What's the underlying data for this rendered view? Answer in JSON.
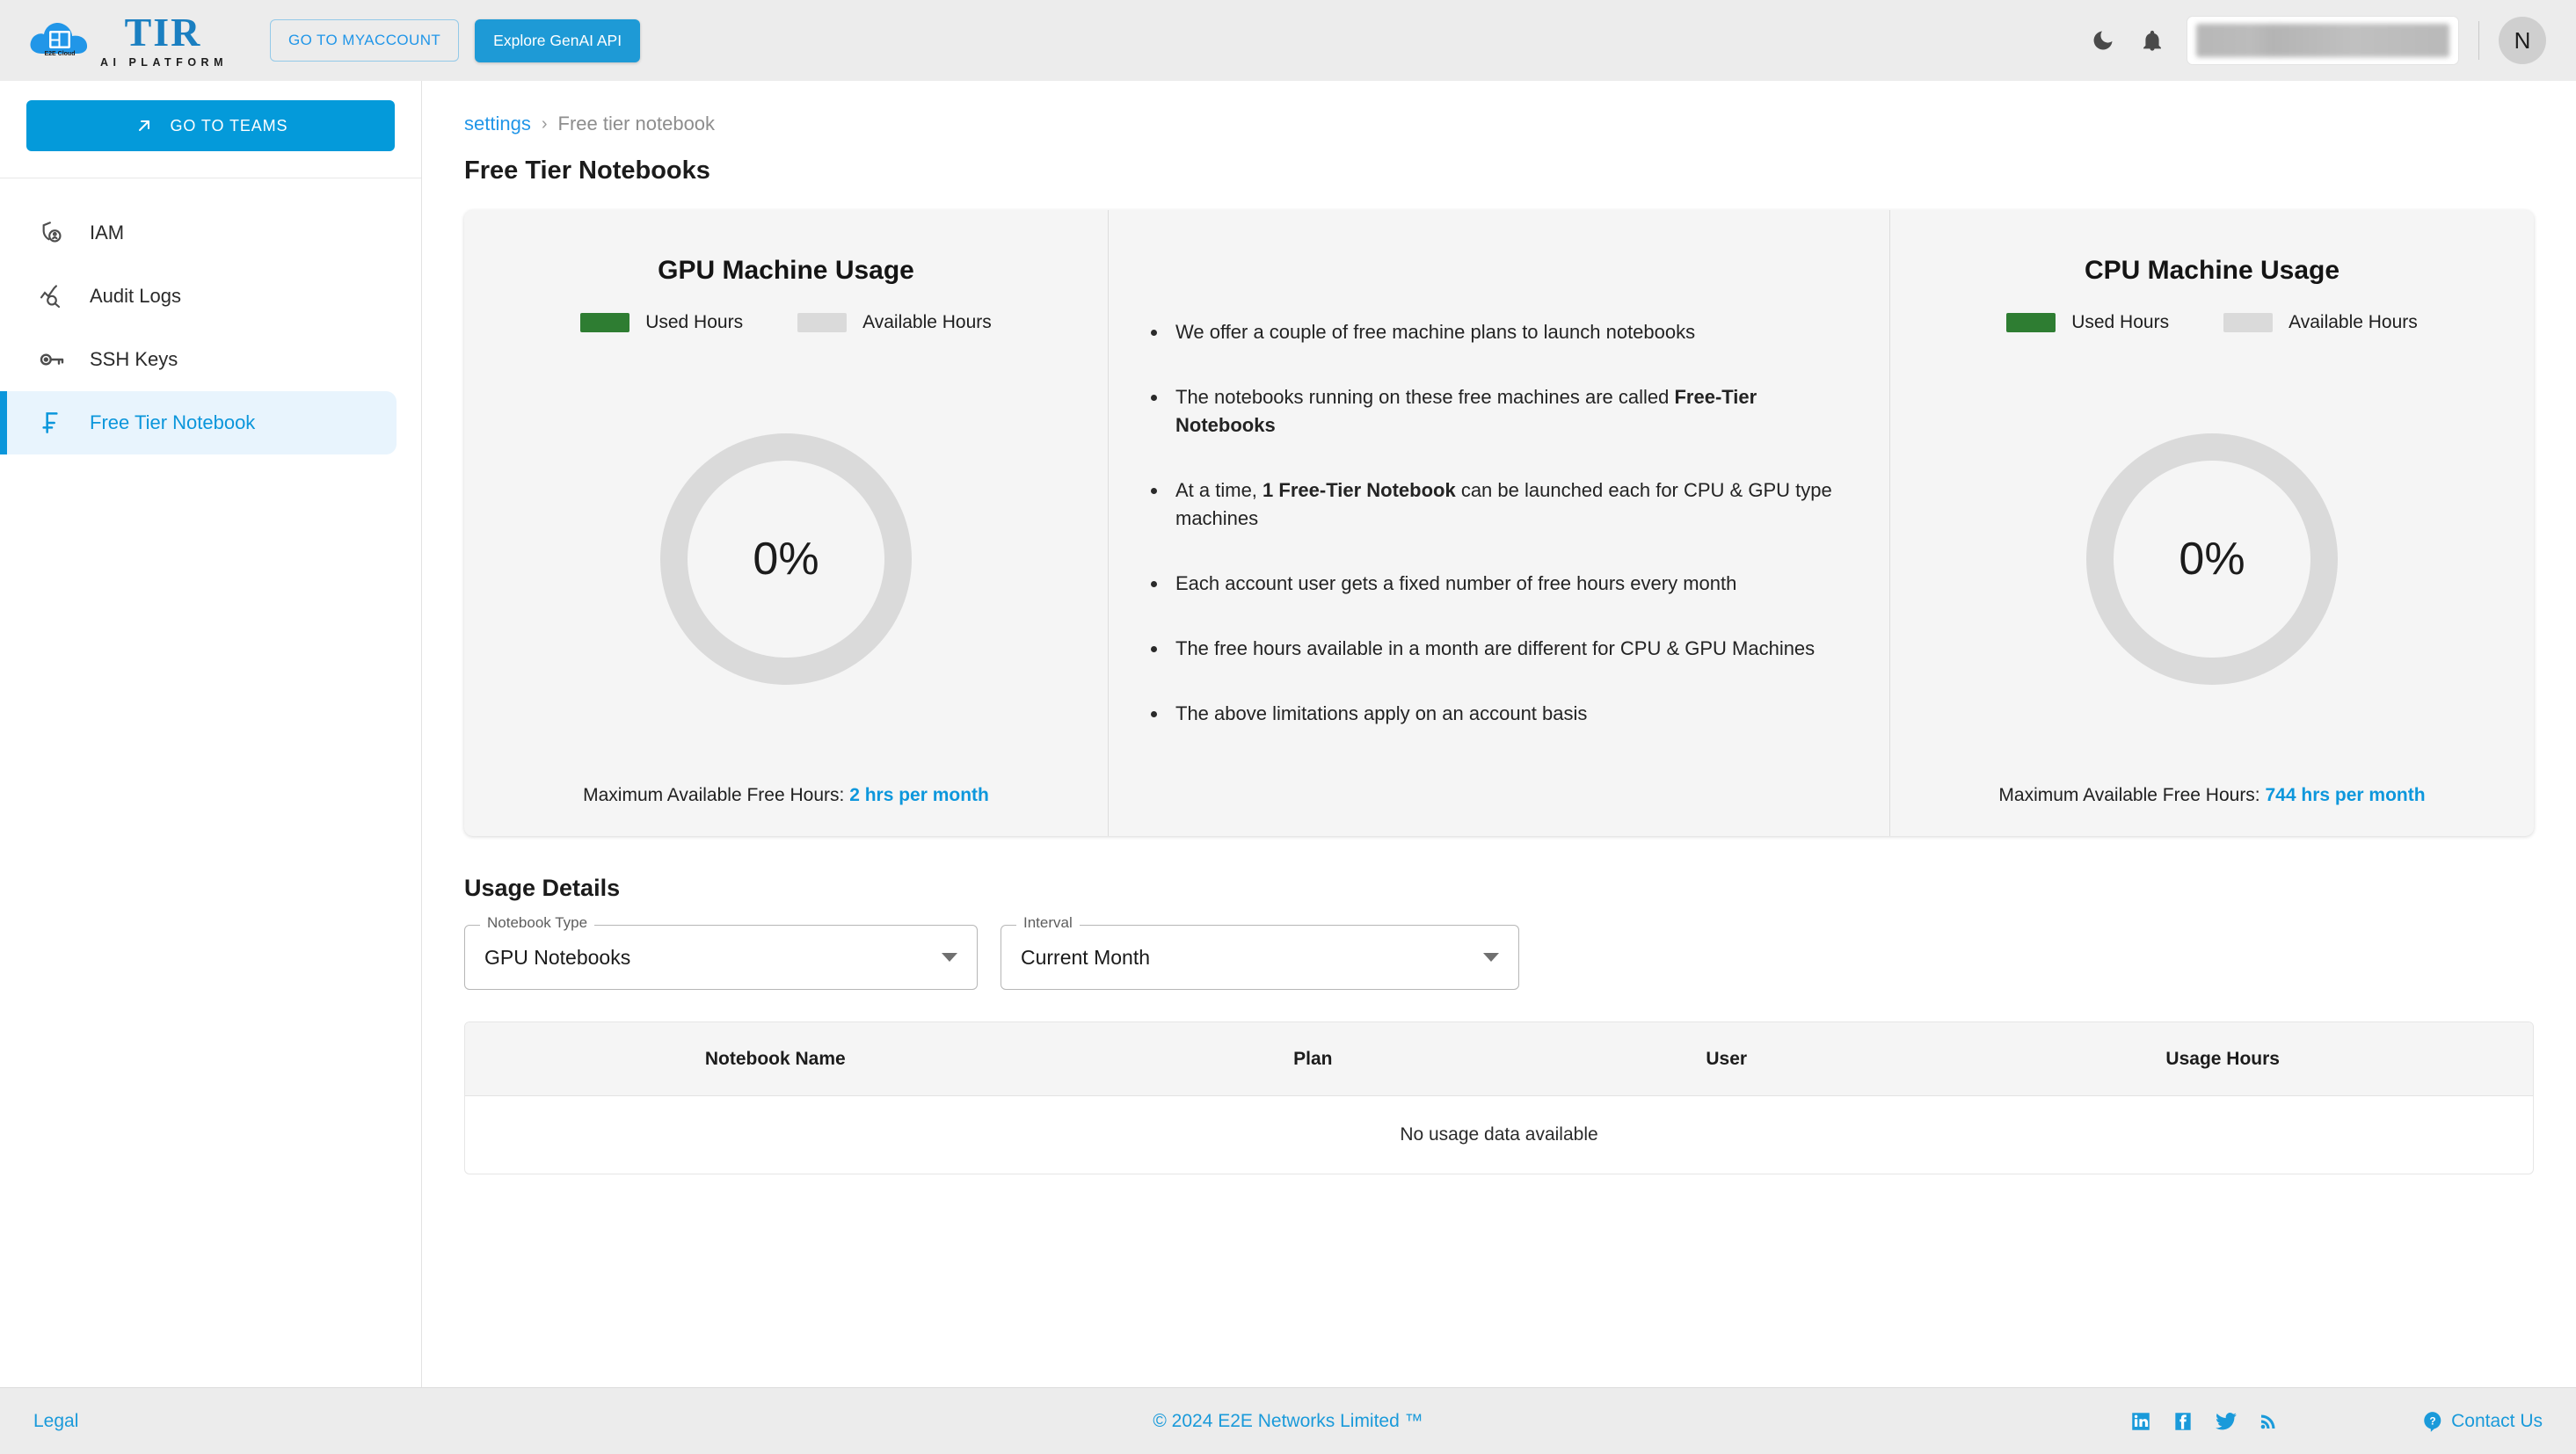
{
  "header": {
    "logo": {
      "brand": "TIR",
      "subtitle": "AI PLATFORM",
      "cloud_text": "E2E Cloud"
    },
    "myaccount_label": "GO TO MYACCOUNT",
    "genai_label": "Explore GenAI API",
    "avatar_initial": "N"
  },
  "sidebar": {
    "teams_button": "GO TO TEAMS",
    "items": [
      {
        "label": "IAM",
        "icon": "shield-user-icon",
        "active": false
      },
      {
        "label": "Audit Logs",
        "icon": "audit-chart-search-icon",
        "active": false
      },
      {
        "label": "SSH Keys",
        "icon": "key-icon",
        "active": false
      },
      {
        "label": "Free Tier Notebook",
        "icon": "free-tier-f-icon",
        "active": true
      }
    ]
  },
  "breadcrumb": {
    "root": "settings",
    "separator": "›",
    "current": "Free tier notebook"
  },
  "page_title": "Free Tier Notebooks",
  "usage": {
    "gpu": {
      "title": "GPU Machine Usage",
      "legend_used": "Used Hours",
      "legend_available": "Available Hours",
      "percent": "0%",
      "max_prefix": "Maximum Available Free Hours:",
      "max_value": "2 hrs per month"
    },
    "cpu": {
      "title": "CPU Machine Usage",
      "legend_used": "Used Hours",
      "legend_available": "Available Hours",
      "percent": "0%",
      "max_prefix": "Maximum Available Free Hours:",
      "max_value": "744 hrs per month"
    },
    "bullets": [
      {
        "pre": "We offer a couple of free machine plans to launch notebooks",
        "bold": "",
        "post": ""
      },
      {
        "pre": "The notebooks running on these free machines are called ",
        "bold": "Free-Tier Notebooks",
        "post": ""
      },
      {
        "pre": "At a time, ",
        "bold": "1 Free-Tier Notebook",
        "post": " can be launched each for CPU & GPU type machines"
      },
      {
        "pre": "Each account user gets a fixed number of free hours every month",
        "bold": "",
        "post": ""
      },
      {
        "pre": "The free hours available in a month are different for CPU & GPU Machines",
        "bold": "",
        "post": ""
      },
      {
        "pre": "The above limitations apply on an account basis",
        "bold": "",
        "post": ""
      }
    ]
  },
  "usage_details": {
    "section_title": "Usage Details",
    "notebook_type": {
      "label": "Notebook Type",
      "value": "GPU Notebooks"
    },
    "interval": {
      "label": "Interval",
      "value": "Current Month"
    },
    "table": {
      "columns": [
        "Notebook Name",
        "Plan",
        "User",
        "Usage Hours"
      ],
      "rows": [],
      "empty_text": "No usage data available"
    }
  },
  "chart_data": [
    {
      "type": "pie",
      "title": "GPU Machine Usage",
      "categories": [
        "Used Hours",
        "Available Hours"
      ],
      "values": [
        0,
        2
      ],
      "unit": "hours",
      "center_label": "0%",
      "colors": [
        "#2e7d32",
        "#dadada"
      ],
      "legend": "top",
      "annotations": [
        "Maximum Available Free Hours: 2 hrs per month"
      ]
    },
    {
      "type": "pie",
      "title": "CPU Machine Usage",
      "categories": [
        "Used Hours",
        "Available Hours"
      ],
      "values": [
        0,
        744
      ],
      "unit": "hours",
      "center_label": "0%",
      "colors": [
        "#2e7d32",
        "#dadada"
      ],
      "legend": "top",
      "annotations": [
        "Maximum Available Free Hours: 744 hrs per month"
      ]
    }
  ],
  "colors": {
    "accent_blue": "#049ada",
    "used_green": "#2e7d32",
    "available_gray": "#dadada",
    "header_bg": "#ececec",
    "card_bg": "#f5f5f5"
  },
  "footer": {
    "legal": "Legal",
    "copyright": "© 2024 E2E Networks Limited ™",
    "contact": "Contact Us",
    "social": [
      "linkedin-icon",
      "facebook-icon",
      "twitter-icon",
      "rss-icon"
    ]
  }
}
